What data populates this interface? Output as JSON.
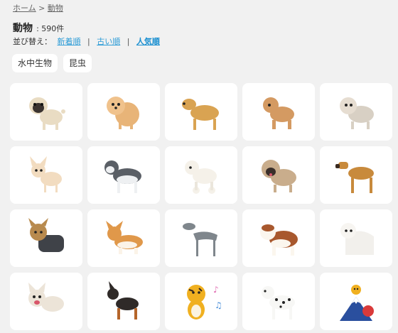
{
  "breadcrumb": {
    "home": "ホーム",
    "separator": ">",
    "current": "動物"
  },
  "title": "動物",
  "count": ": 590件",
  "sort": {
    "label": "並び替え：",
    "options": [
      "新着順",
      "古い順",
      "人気順"
    ],
    "active": "人気順"
  },
  "tags": [
    "水中生物",
    "昆虫"
  ],
  "cards": [
    {
      "name": "pug",
      "icon": "pug-illustration"
    },
    {
      "name": "pomeranian",
      "icon": "pomeranian-illustration"
    },
    {
      "name": "golden-retriever",
      "icon": "golden-retriever-illustration"
    },
    {
      "name": "toy-poodle",
      "icon": "toy-poodle-illustration"
    },
    {
      "name": "shih-tzu",
      "icon": "shih-tzu-illustration"
    },
    {
      "name": "chihuahua",
      "icon": "chihuahua-illustration"
    },
    {
      "name": "husky",
      "icon": "husky-illustration"
    },
    {
      "name": "white-poodle",
      "icon": "white-poodle-illustration"
    },
    {
      "name": "pekingese",
      "icon": "pekingese-illustration"
    },
    {
      "name": "great-dane",
      "icon": "great-dane-illustration"
    },
    {
      "name": "yorkshire-terrier",
      "icon": "yorkshire-terrier-illustration"
    },
    {
      "name": "corgi",
      "icon": "corgi-illustration"
    },
    {
      "name": "greyhound",
      "icon": "greyhound-illustration"
    },
    {
      "name": "saint-bernard",
      "icon": "saint-bernard-illustration"
    },
    {
      "name": "maltese",
      "icon": "maltese-illustration"
    },
    {
      "name": "french-bulldog",
      "icon": "french-bulldog-illustration"
    },
    {
      "name": "doberman",
      "icon": "doberman-illustration"
    },
    {
      "name": "tiger-singing",
      "icon": "tiger-singing-illustration"
    },
    {
      "name": "dalmatian",
      "icon": "dalmatian-illustration"
    },
    {
      "name": "tiger-mount-fuji",
      "icon": "tiger-mount-fuji-illustration"
    }
  ],
  "colors": {
    "link": "#2b9bd6",
    "background": "#f1f1f1",
    "card": "#ffffff"
  }
}
